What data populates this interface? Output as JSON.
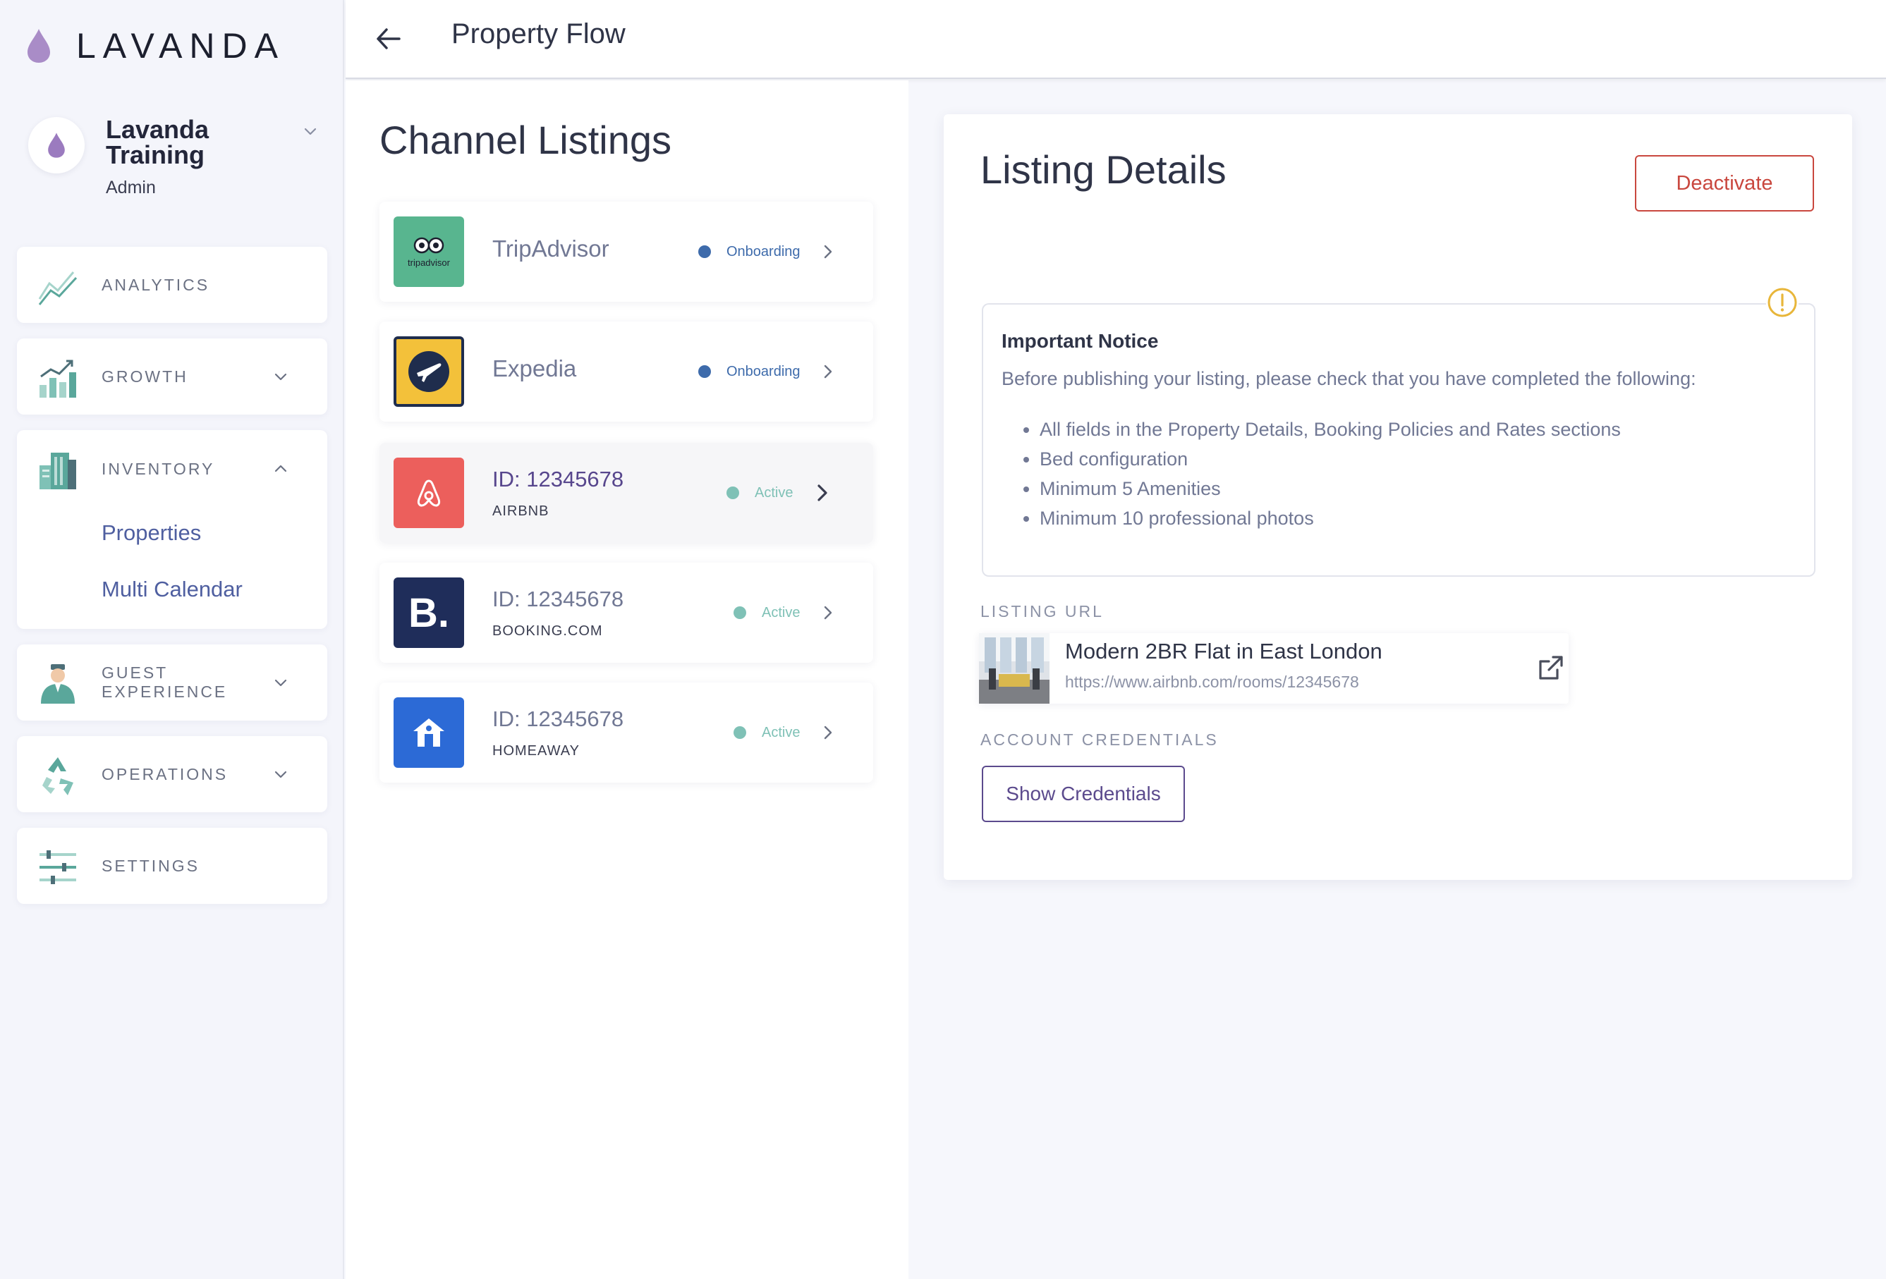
{
  "app": {
    "logo_text": "LAVANDA"
  },
  "account": {
    "name": "Lavanda Training",
    "role": "Admin"
  },
  "nav": {
    "analytics": "ANALYTICS",
    "growth": "GROWTH",
    "inventory": "INVENTORY",
    "inventory_items": [
      "Properties",
      "Multi Calendar"
    ],
    "guest_experience_line1": "GUEST",
    "guest_experience_line2": "EXPERIENCE",
    "operations": "OPERATIONS",
    "settings": "SETTINGS"
  },
  "header": {
    "title": "Property Flow"
  },
  "channels": {
    "title": "Channel Listings",
    "rows": [
      {
        "name": "TripAdvisor",
        "status": "Onboarding",
        "status_color": "#3e6bab",
        "logo_text": "tripadvisor"
      },
      {
        "name": "Expedia",
        "status": "Onboarding",
        "status_color": "#3e6bab"
      },
      {
        "id": "ID: 12345678",
        "channel": "AIRBNB",
        "status": "Active",
        "status_color": "#7fc1b6"
      },
      {
        "id": "ID: 12345678",
        "channel": "BOOKING.COM",
        "status": "Active",
        "status_color": "#7fc1b6",
        "logo_text": "B."
      },
      {
        "id": "ID: 12345678",
        "channel": "HOMEAWAY",
        "status": "Active",
        "status_color": "#7fc1b6"
      }
    ]
  },
  "details": {
    "title": "Listing Details",
    "deactivate_label": "Deactivate",
    "notice": {
      "title": "Important Notice",
      "body": "Before publishing your listing, please check that you have completed the following:",
      "items": [
        "All fields in the Property Details, Booking Policies and Rates sections",
        "Bed configuration",
        "Minimum 5 Amenities",
        "Minimum 10 professional photos"
      ]
    },
    "listing_url_label": "LISTING URL",
    "listing_title": "Modern 2BR Flat in East London",
    "listing_url": "https://www.airbnb.com/rooms/12345678",
    "credentials_label": "ACCOUNT CREDENTIALS",
    "show_credentials_label": "Show Credentials"
  },
  "colors": {
    "accent_purple": "#5b4a8d",
    "danger": "#c9473e",
    "teal": "#5aa79b",
    "onboarding_blue": "#3e6bab",
    "active_teal": "#7fc1b6",
    "warning_yellow": "#e8b63a"
  }
}
